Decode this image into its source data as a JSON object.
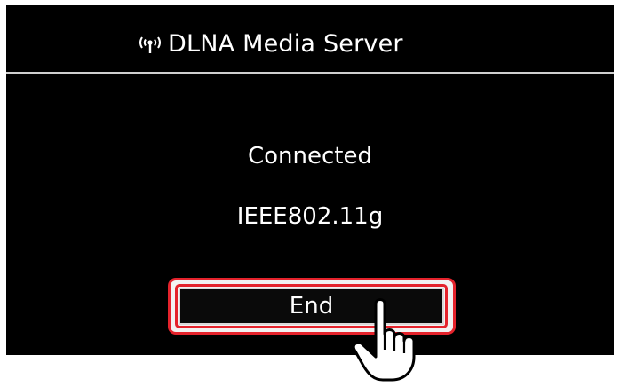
{
  "header": {
    "icon": "wifi-broadcast-icon",
    "title": "DLNA Media Server"
  },
  "status": {
    "connection": "Connected",
    "standard": "IEEE802.11g"
  },
  "actions": {
    "end_label": "End",
    "pointer_icon": "pointing-hand-icon"
  },
  "colors": {
    "screen_background": "#000000",
    "text": "#ffffff",
    "highlight": "#e4232c"
  }
}
